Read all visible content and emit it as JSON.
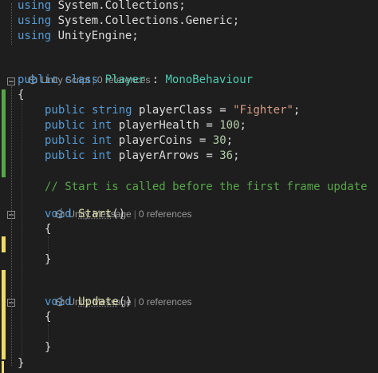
{
  "colors": {
    "background": "#1e1e1e",
    "keyword": "#569cd6",
    "type": "#4ec9b0",
    "string": "#d69d85",
    "number": "#b5cea8",
    "comment": "#57a64a",
    "method": "#dcdcaa",
    "text": "#dcdcdc",
    "codelens": "#999999",
    "change_saved": "#57a64a",
    "change_unsaved": "#eedb6a"
  },
  "usings": [
    {
      "kw": "using",
      "ns": "System.Collections;"
    },
    {
      "kw": "using",
      "ns": "System.Collections.Generic;"
    },
    {
      "kw": "using",
      "ns": "UnityEngine;"
    }
  ],
  "class_lens": {
    "icon": "unity-script-icon",
    "label": "Unity Script",
    "refs": "0 references"
  },
  "class_decl": {
    "mod": "public",
    "kw": "class",
    "name": "Player",
    "colon": ":",
    "base": "MonoBehaviour"
  },
  "open_brace": "{",
  "close_brace": "}",
  "fields": [
    {
      "mod": "public",
      "type": "string",
      "name": "playerClass",
      "eq": "=",
      "value": "\"Fighter\"",
      "end": ";",
      "value_kind": "str"
    },
    {
      "mod": "public",
      "type": "int",
      "name": "playerHealth",
      "eq": "=",
      "value": "100",
      "end": ";",
      "value_kind": "num"
    },
    {
      "mod": "public",
      "type": "int",
      "name": "playerCoins",
      "eq": "=",
      "value": "30",
      "end": ";",
      "value_kind": "num"
    },
    {
      "mod": "public",
      "type": "int",
      "name": "playerArrows",
      "eq": "=",
      "value": "36",
      "end": ";",
      "value_kind": "num"
    }
  ],
  "comment": "// Start is called before the first frame update",
  "start": {
    "lens": {
      "icon": "unity-message-icon",
      "label": "Unity Message",
      "refs": "0 references"
    },
    "kw": "void",
    "name": "Start",
    "parens": "()"
  },
  "update": {
    "lens": {
      "icon": "unity-message-icon",
      "label": "Unity Message",
      "refs": "0 references"
    },
    "kw": "void",
    "name": "Update",
    "parens": "()"
  }
}
